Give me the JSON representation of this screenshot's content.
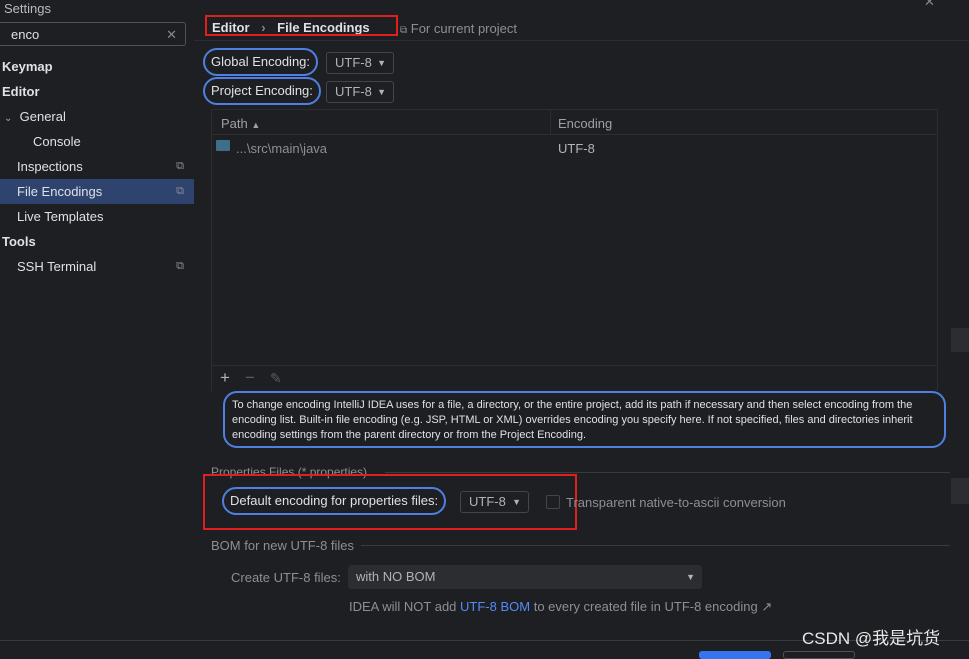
{
  "window": {
    "title": "Settings",
    "close_icon": "close-icon"
  },
  "sidebar": {
    "search": {
      "value": "enco",
      "clear_icon": "close-icon"
    },
    "items": [
      {
        "label": "Keymap",
        "bold": true
      },
      {
        "label": "Editor",
        "bold": true
      },
      {
        "label": "General",
        "expanded": true
      },
      {
        "label": "Console"
      },
      {
        "label": "Inspections",
        "project_icon": true
      },
      {
        "label": "File Encodings",
        "selected": true,
        "project_icon": true
      },
      {
        "label": "Live Templates"
      },
      {
        "label": "Tools",
        "bold": true
      },
      {
        "label": "SSH Terminal",
        "project_icon": true
      }
    ]
  },
  "header": {
    "breadcrumb": [
      "Editor",
      "File Encodings"
    ],
    "scope": "For current project"
  },
  "encodings": {
    "global_label": "Global Encoding:",
    "global_value": "UTF-8",
    "project_label": "Project Encoding:",
    "project_value": "UTF-8"
  },
  "table": {
    "columns": [
      "Path",
      "Encoding"
    ],
    "rows": [
      {
        "path": "...\\src\\main\\java",
        "encoding": "UTF-8"
      }
    ],
    "toolbar": {
      "add": "+",
      "remove": "−",
      "edit": "✎"
    }
  },
  "help_text": "To change encoding IntelliJ IDEA uses for a file, a directory, or the entire project, add its path if necessary and then select encoding from the encoding list. Built-in file encoding (e.g. JSP, HTML or XML) overrides encoding you specify here. If not specified, files and directories inherit encoding settings from the parent directory or from the Project Encoding.",
  "properties": {
    "section": "Properties Files (*.properties)",
    "default_label": "Default encoding for properties files:",
    "default_value": "UTF-8",
    "transparent_label": "Transparent native-to-ascii conversion",
    "transparent_checked": false
  },
  "bom": {
    "section": "BOM for new UTF-8 files",
    "create_label": "Create UTF-8 files:",
    "create_value": "with NO BOM",
    "note_prefix": "IDEA will NOT add ",
    "note_link": "UTF-8 BOM",
    "note_suffix": " to every created file in UTF-8 encoding ↗"
  },
  "watermark": "CSDN @我是坑货",
  "colors": {
    "accent": "#2e436e",
    "annotation_oval": "#4f7fe0",
    "annotation_box": "#e01f1f",
    "link": "#548af7"
  }
}
